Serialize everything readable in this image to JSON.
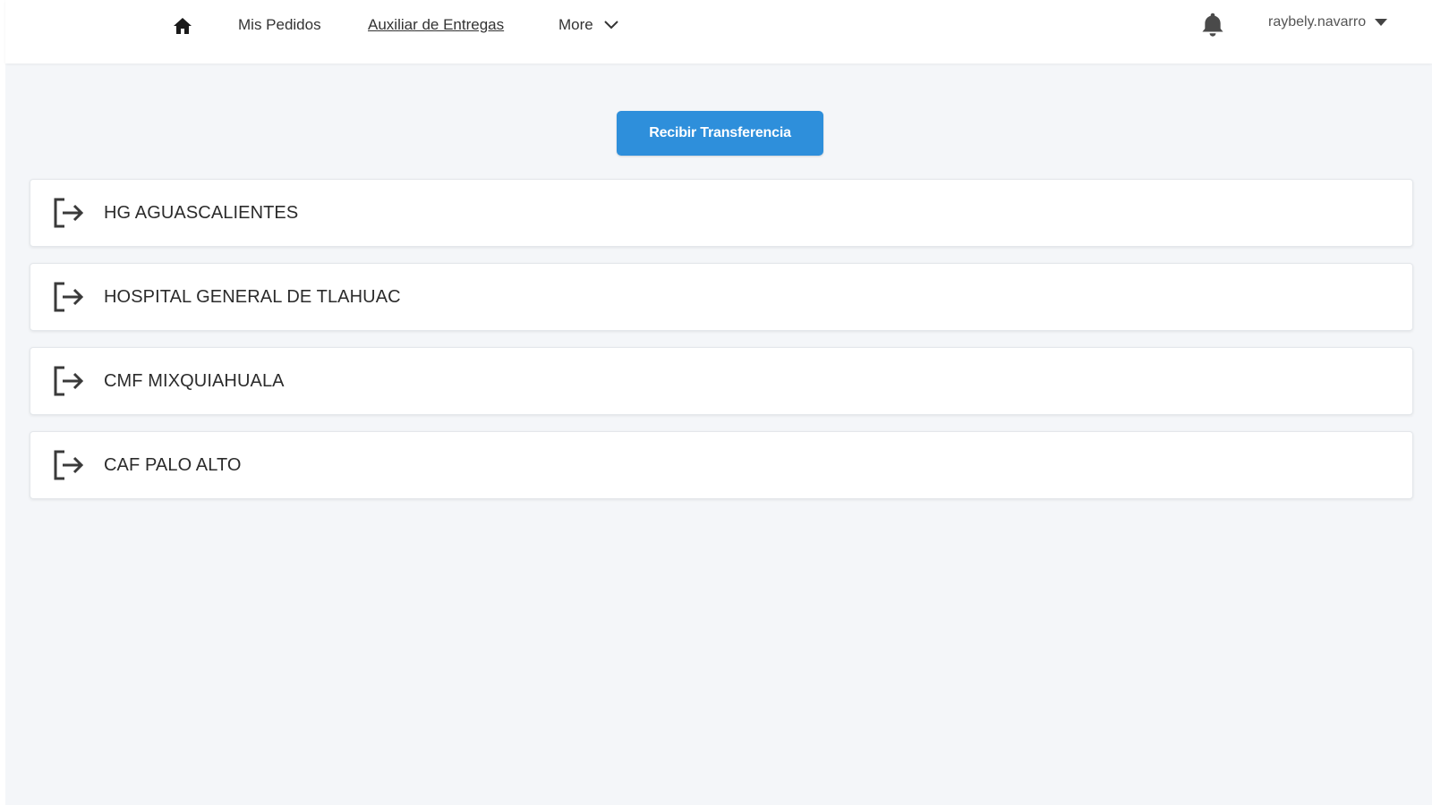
{
  "nav": {
    "home_icon": "home-icon",
    "links": [
      {
        "label": "Mis Pedidos",
        "active": false
      },
      {
        "label": "Auxiliar de Entregas",
        "active": true
      }
    ],
    "more_label": "More",
    "notification_icon": "bell-icon",
    "username": "raybely.navarro"
  },
  "main": {
    "receive_button_label": "Recibir Transferencia",
    "locations": [
      {
        "name": "HG AGUASCALIENTES",
        "icon": "sign-out-icon"
      },
      {
        "name": "HOSPITAL GENERAL DE TLAHUAC",
        "icon": "sign-out-icon"
      },
      {
        "name": "CMF MIXQUIAHUALA",
        "icon": "sign-out-icon"
      },
      {
        "name": "CAF PALO ALTO",
        "icon": "sign-out-icon"
      }
    ]
  },
  "colors": {
    "accent": "#2e8fdb",
    "background": "#f4f6f9",
    "card": "#ffffff",
    "text": "#333333"
  }
}
